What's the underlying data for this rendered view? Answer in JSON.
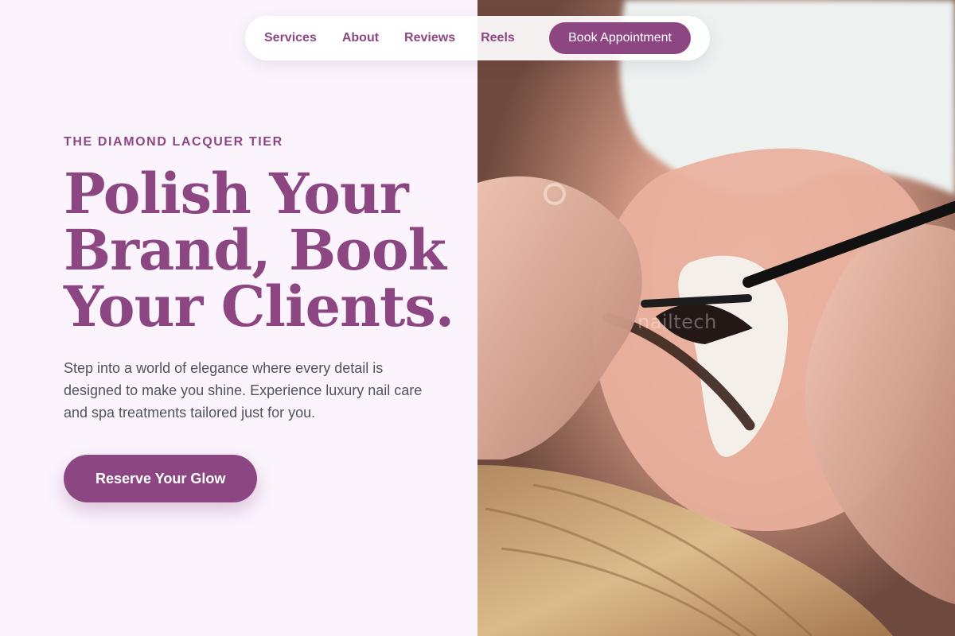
{
  "nav": {
    "items": [
      {
        "label": "Services"
      },
      {
        "label": "About"
      },
      {
        "label": "Reviews"
      },
      {
        "label": "Reels"
      }
    ],
    "book_label": "Book Appointment"
  },
  "hero": {
    "eyebrow": "THE DIAMOND LACQUER TIER",
    "headline": "Polish Your Brand, Book Your Clients.",
    "lead": "Step into a world of elegance where every detail is designed to make you shine. Experience luxury nail care and spa treatments tailored just for you.",
    "cta_label": "Reserve Your Glow",
    "image_watermark": "nailtech"
  },
  "colors": {
    "brand": "#8c4783",
    "background": "#fbf4fd",
    "body_text": "#4f5360",
    "button_text": "#ffffff"
  }
}
